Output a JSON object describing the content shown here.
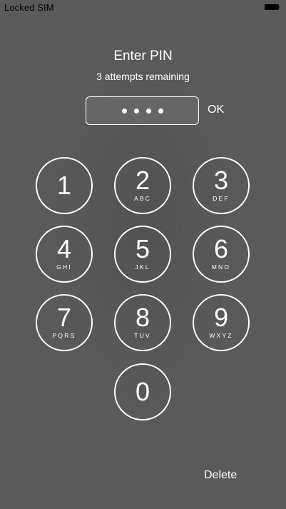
{
  "status_bar": {
    "carrier": "Locked SIM"
  },
  "prompt": {
    "title": "Enter PIN",
    "subtitle": "3 attempts remaining"
  },
  "pin": {
    "entered_digits": 4,
    "ok_label": "OK"
  },
  "keypad": [
    {
      "digit": "1",
      "letters": ""
    },
    {
      "digit": "2",
      "letters": "ABC"
    },
    {
      "digit": "3",
      "letters": "DEF"
    },
    {
      "digit": "4",
      "letters": "GHI"
    },
    {
      "digit": "5",
      "letters": "JKL"
    },
    {
      "digit": "6",
      "letters": "MNO"
    },
    {
      "digit": "7",
      "letters": "PQRS"
    },
    {
      "digit": "8",
      "letters": "TUV"
    },
    {
      "digit": "9",
      "letters": "WXYZ"
    },
    {
      "digit": "0",
      "letters": ""
    }
  ],
  "footer": {
    "delete_label": "Delete"
  },
  "colors": {
    "background": "#5a5a5a",
    "foreground": "#ffffff",
    "status_text": "#000000"
  }
}
